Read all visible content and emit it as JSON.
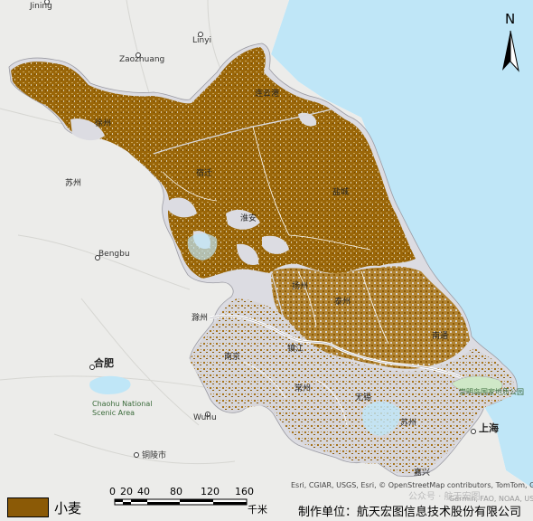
{
  "legend": {
    "label": "小麦",
    "color": "#8b5a06"
  },
  "north_arrow": {
    "letter": "N"
  },
  "scale_bar": {
    "ticks": [
      "0",
      "20",
      "40",
      "80",
      "120",
      "160"
    ],
    "unit": "千米"
  },
  "attribution": "Esri, CGIAR, USGS, Esri, © OpenStreetMap contributors, TomTom, Garmin, FAO, NOAA, USGS",
  "producer": "制作单位：航天宏图信息技术股份有限公司",
  "watermark": "公众号 · 航天宏图",
  "watermark_small": "Garmin, FAO, NOAA, USGS",
  "colors": {
    "land": "#ececea",
    "sea": "#bfe6f7",
    "province": "#dcdce2",
    "wheat": "#8b5a06",
    "river": "#ffffff"
  },
  "places": {
    "jining": "Jining",
    "linyi": "Linyi",
    "zaozhuang": "Zaozhuang",
    "lianyungang": "连云港",
    "xuzhou": "徐州",
    "suzhou_ah": "苏州",
    "suqian": "宿迁",
    "yancheng": "盐城",
    "huaian": "淮安",
    "bengbu": "Bengbu",
    "yangzhou": "扬州",
    "taizhou": "泰州",
    "chuzhou": "滁州",
    "nantong": "南通",
    "nanjing": "南京",
    "zhenjiang": "镇江",
    "hefei": "合肥",
    "changzhou": "常州",
    "wuxi": "无锡",
    "chaohu": "Chaohu National\nScenic Area",
    "shanghai": "上海",
    "suzhou_js": "苏州",
    "wuhu": "Wuhu",
    "tongling": "铜陵市",
    "jiaxing": "嘉兴",
    "chongming": "崇明岛国家地质公园"
  }
}
